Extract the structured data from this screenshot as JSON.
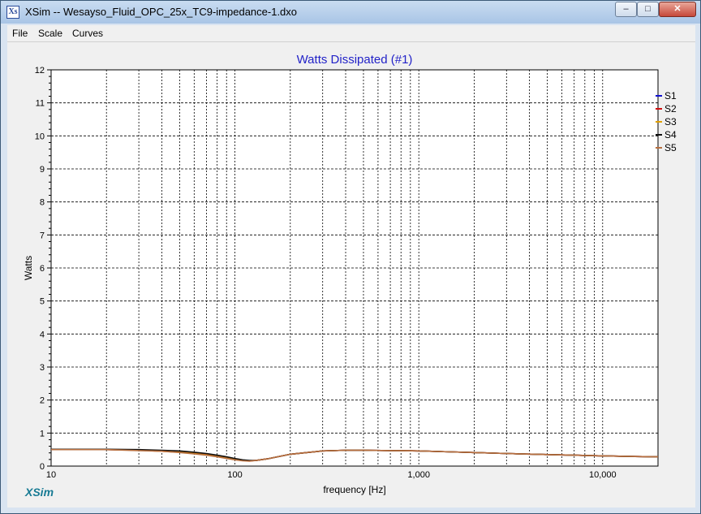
{
  "window": {
    "title": "XSim -- Wesayso_Fluid_OPC_25x_TC9-impedance-1.dxo",
    "icon": "xsim-app-icon",
    "controls": {
      "minimize": "–",
      "maximize": "□",
      "close": "✕"
    }
  },
  "menu": {
    "items": [
      "File",
      "Scale",
      "Curves"
    ]
  },
  "brand": "XSim",
  "chart_data": {
    "type": "line",
    "title": "Watts Dissipated (#1)",
    "xlabel": "frequency [Hz]",
    "ylabel": "Watts",
    "xscale": "log",
    "xlim": [
      10,
      20000
    ],
    "ylim": [
      0,
      12
    ],
    "grid": true,
    "legend_placement": "right",
    "x_ticks": [
      {
        "value": 10,
        "label": "10"
      },
      {
        "value": 100,
        "label": "100"
      },
      {
        "value": 1000,
        "label": "1,000"
      },
      {
        "value": 10000,
        "label": "10,000"
      }
    ],
    "y_ticks": [
      "0",
      "1",
      "2",
      "3",
      "4",
      "5",
      "6",
      "7",
      "8",
      "9",
      "10",
      "11",
      "12"
    ],
    "x": [
      10,
      20,
      30,
      40,
      50,
      60,
      70,
      80,
      90,
      100,
      110,
      120,
      130,
      150,
      200,
      300,
      400,
      500,
      700,
      1000,
      1500,
      2000,
      3000,
      5000,
      7000,
      10000,
      15000,
      20000
    ],
    "series": [
      {
        "name": "S1",
        "color": "#1010d0",
        "values": [
          0.5,
          0.5,
          0.48,
          0.46,
          0.43,
          0.4,
          0.36,
          0.31,
          0.26,
          0.21,
          0.18,
          0.16,
          0.17,
          0.22,
          0.36,
          0.46,
          0.48,
          0.48,
          0.47,
          0.46,
          0.43,
          0.41,
          0.38,
          0.35,
          0.33,
          0.31,
          0.29,
          0.28
        ]
      },
      {
        "name": "S2",
        "color": "#d01010",
        "values": [
          0.5,
          0.5,
          0.48,
          0.45,
          0.42,
          0.39,
          0.35,
          0.3,
          0.25,
          0.2,
          0.17,
          0.16,
          0.17,
          0.22,
          0.36,
          0.46,
          0.48,
          0.48,
          0.47,
          0.46,
          0.43,
          0.41,
          0.38,
          0.35,
          0.33,
          0.31,
          0.29,
          0.28
        ]
      },
      {
        "name": "S3",
        "color": "#e0a000",
        "values": [
          0.5,
          0.5,
          0.48,
          0.45,
          0.42,
          0.38,
          0.34,
          0.29,
          0.24,
          0.2,
          0.17,
          0.16,
          0.17,
          0.22,
          0.36,
          0.46,
          0.48,
          0.48,
          0.47,
          0.46,
          0.43,
          0.41,
          0.38,
          0.35,
          0.33,
          0.31,
          0.29,
          0.28
        ]
      },
      {
        "name": "S4",
        "color": "#101010",
        "values": [
          0.51,
          0.51,
          0.5,
          0.48,
          0.46,
          0.42,
          0.38,
          0.33,
          0.28,
          0.23,
          0.19,
          0.17,
          0.17,
          0.22,
          0.36,
          0.46,
          0.48,
          0.48,
          0.47,
          0.46,
          0.43,
          0.41,
          0.38,
          0.35,
          0.33,
          0.31,
          0.29,
          0.28
        ]
      },
      {
        "name": "S5",
        "color": "#b87040",
        "values": [
          0.5,
          0.5,
          0.47,
          0.45,
          0.41,
          0.37,
          0.33,
          0.28,
          0.23,
          0.19,
          0.16,
          0.15,
          0.17,
          0.22,
          0.36,
          0.46,
          0.48,
          0.48,
          0.47,
          0.46,
          0.43,
          0.41,
          0.38,
          0.35,
          0.33,
          0.31,
          0.29,
          0.28
        ]
      }
    ]
  }
}
